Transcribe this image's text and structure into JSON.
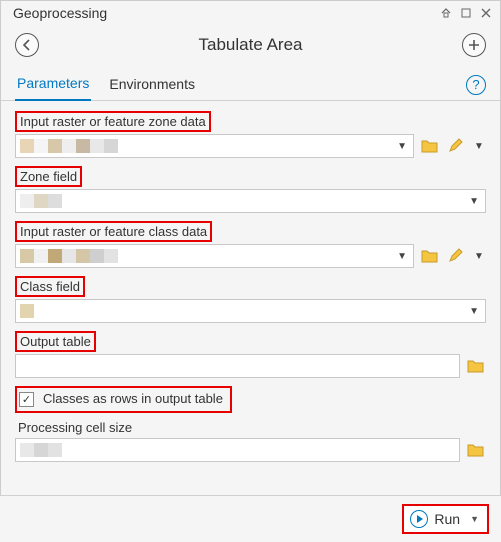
{
  "window": {
    "title": "Geoprocessing"
  },
  "tool": {
    "title": "Tabulate Area"
  },
  "tabs": {
    "parameters": "Parameters",
    "environments": "Environments",
    "help": "?"
  },
  "labels": {
    "zone_data": "Input raster or feature zone data",
    "zone_field": "Zone field",
    "class_data": "Input raster or feature class data",
    "class_field": "Class field",
    "output_table": "Output table",
    "classes_rows": "Classes as rows in output table",
    "cell_size": "Processing cell size"
  },
  "values": {
    "zone_data": "",
    "zone_field": "",
    "class_data": "",
    "class_field": "",
    "output_table": "",
    "cell_size": ""
  },
  "checks": {
    "classes_rows": "✓"
  },
  "footer": {
    "run": "Run"
  },
  "swatches": {
    "zone": [
      "#e8d5b5",
      "#f5f5f5",
      "#d6c8a8",
      "#eeeeee",
      "#c7b9a3",
      "#e8e8e8",
      "#d6d6d6"
    ],
    "zonefield": [
      "#eeeeee",
      "#e0d6c4",
      "#dddddd"
    ],
    "class": [
      "#d8c9a6",
      "#f0f0f0",
      "#c2a878",
      "#e6e6e6",
      "#d6c6a8",
      "#cfcfcf",
      "#e2e2e2"
    ],
    "classfield": [
      "#e3d4b0"
    ],
    "cell": [
      "#e8e8e8",
      "#d6d6d6",
      "#e2e2e2"
    ]
  }
}
